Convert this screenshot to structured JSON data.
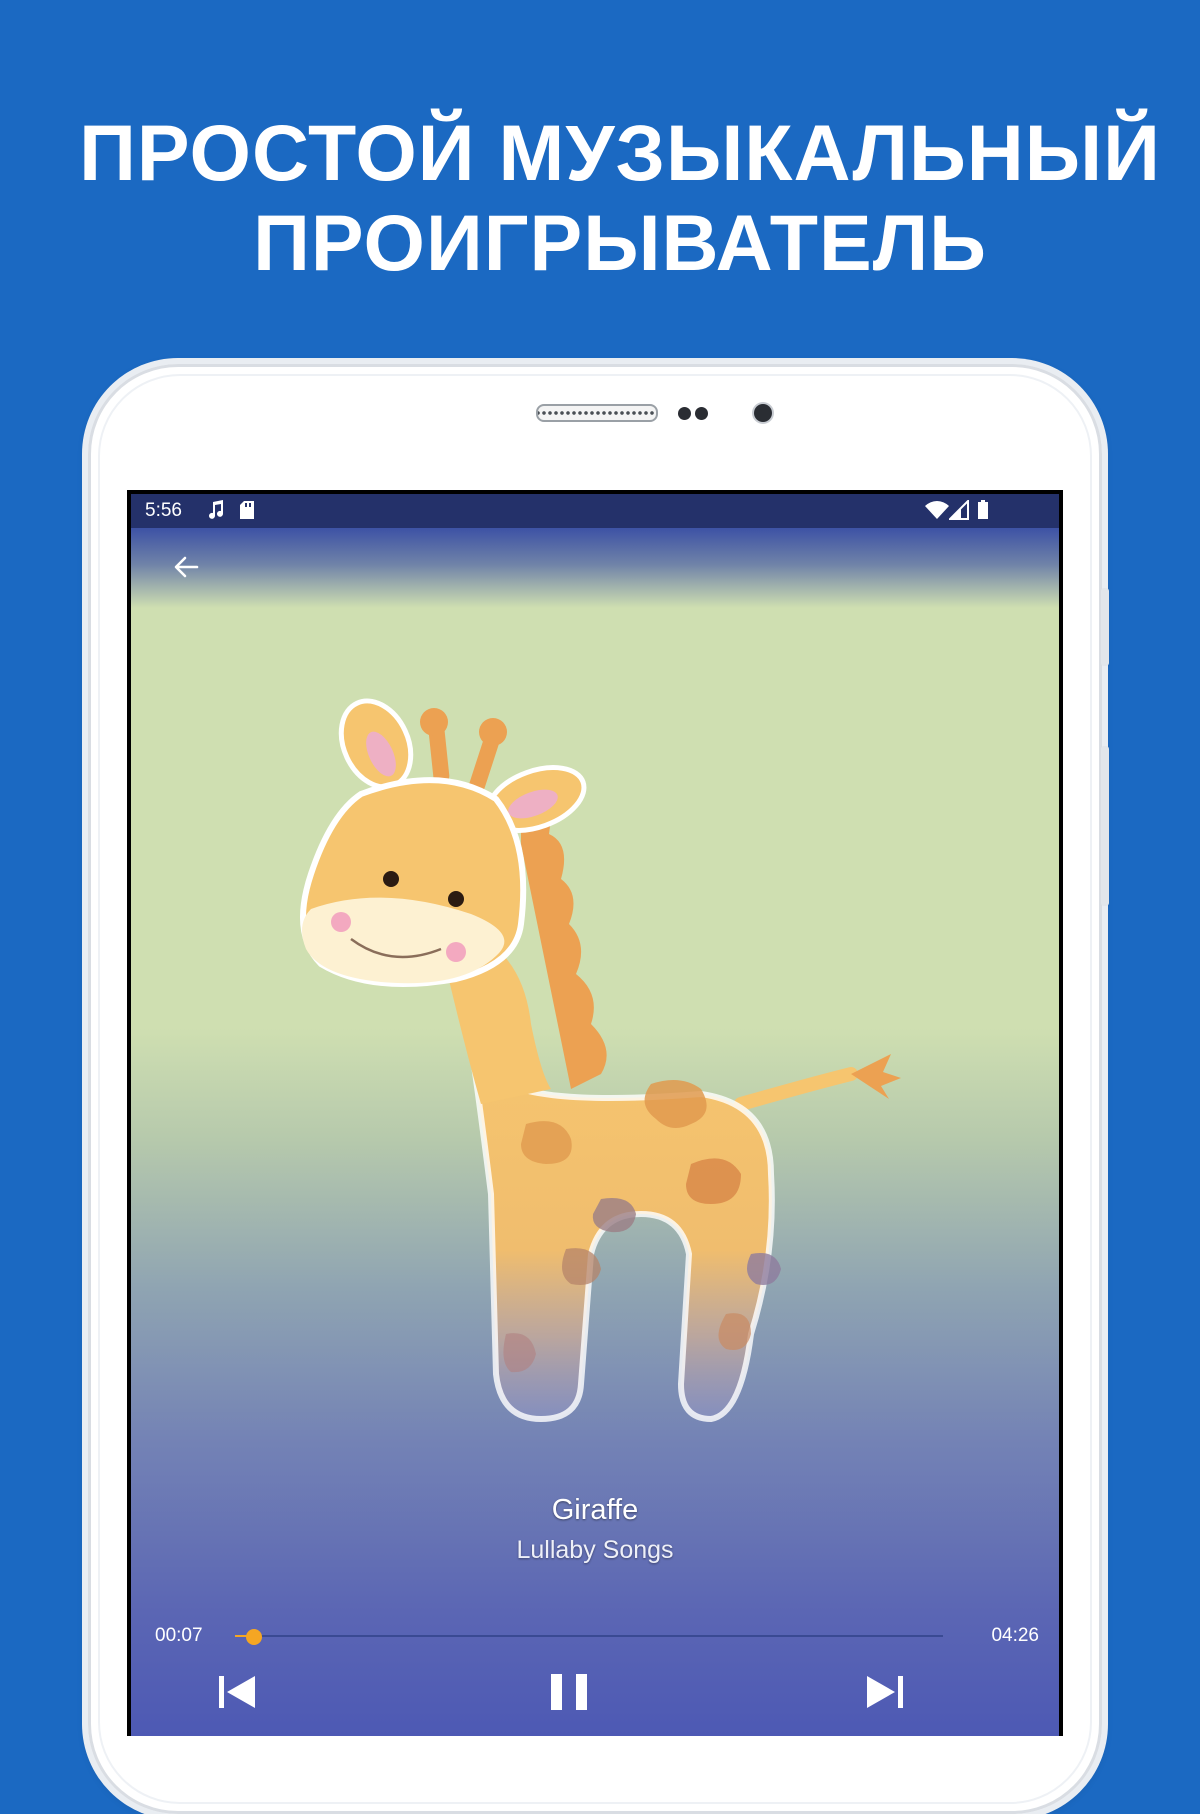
{
  "headline": {
    "line1": "ПРОСТОЙ МУЗЫКАЛЬНЫЙ",
    "line2": "ПРОИГРЫВАТЕЛЬ"
  },
  "status_bar": {
    "time": "5:56",
    "icons": [
      "music-note-icon",
      "sd-card-icon",
      "wifi-icon",
      "cell-signal-icon",
      "battery-icon"
    ]
  },
  "toolbar": {
    "back_icon": "arrow-left-icon"
  },
  "player": {
    "title": "Giraffe",
    "artist": "Lullaby Songs",
    "elapsed": "00:07",
    "duration": "04:26",
    "progress": 0.027,
    "controls": [
      "skip-previous-icon",
      "pause-icon",
      "skip-next-icon"
    ]
  },
  "colors": {
    "background": "#1b69c2",
    "status_bar": "#24316a",
    "accent": "#f5a623",
    "headline_text": "#ffffff"
  }
}
